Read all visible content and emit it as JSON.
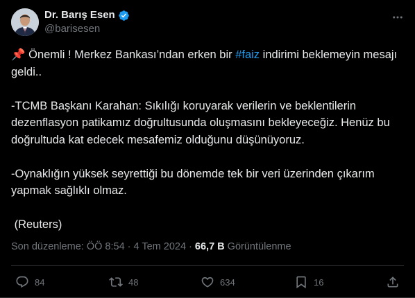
{
  "author": {
    "name": "Dr. Barış Esen",
    "handle": "@barisesen"
  },
  "tweet": {
    "pin_emoji": "📌",
    "line1_before_hashtag": "Önemli ! Merkez Bankası’ndan erken bir ",
    "hashtag": "#faiz",
    "line1_after_hashtag": " indirimi beklemeyin mesajı geldi..",
    "paragraph2": "-TCMB Başkanı Karahan: Sıkılığı koruyarak verilerin ve beklentilerin dezenflasyon patikamız doğrultusunda oluşmasını bekleyeceğiz. Henüz bu doğrultuda kat edecek mesafemiz olduğunu düşünüyoruz.",
    "paragraph3": "-Oynaklığın yüksek seyrettiği bu dönemde tek bir veri üzerinden çıkarım yapmak sağlıklı olmaz.",
    "source": " (Reuters)"
  },
  "meta": {
    "edited_label": "Son düzenleme: ÖÖ 8:54 · 4 Tem 2024 · ",
    "views_count": "66,7 B",
    "views_label": " Görüntülenme"
  },
  "actions": {
    "replies": "84",
    "reposts": "48",
    "likes": "634",
    "bookmarks": "16"
  },
  "colors": {
    "background": "#000000",
    "text": "#e7e9ea",
    "secondary": "#71767b",
    "accent": "#1d9bf0",
    "verified": "#1d9bf0"
  },
  "icons": {
    "more": "more-icon",
    "verified": "verified-badge-icon",
    "reply": "reply-icon",
    "repost": "repost-icon",
    "like": "heart-icon",
    "bookmark": "bookmark-icon",
    "share": "share-icon"
  }
}
